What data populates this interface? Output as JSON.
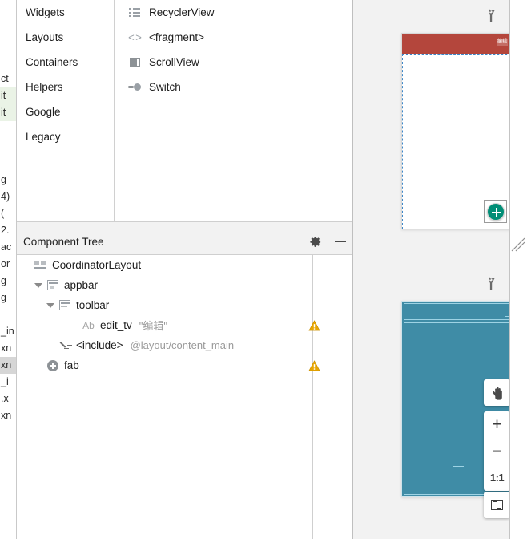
{
  "gutter": {
    "rows": [
      {
        "text": "",
        "state": "plain"
      },
      {
        "text": "",
        "state": "plain"
      },
      {
        "text": "",
        "state": "plain"
      },
      {
        "text": "",
        "state": "plain"
      },
      {
        "text": "ct",
        "state": "plain"
      },
      {
        "text": "it",
        "state": "green"
      },
      {
        "text": "it",
        "state": "green"
      },
      {
        "text": "",
        "state": "plain"
      },
      {
        "text": "",
        "state": "plain"
      },
      {
        "text": "",
        "state": "plain"
      },
      {
        "text": "g",
        "state": "plain"
      },
      {
        "text": "4)",
        "state": "plain"
      },
      {
        "text": "(",
        "state": "plain"
      },
      {
        "text": "2.",
        "state": "plain"
      },
      {
        "text": "ac",
        "state": "plain"
      },
      {
        "text": "or",
        "state": "plain"
      },
      {
        "text": "g",
        "state": "plain"
      },
      {
        "text": "g",
        "state": "plain"
      },
      {
        "text": "",
        "state": "plain"
      },
      {
        "text": "_in",
        "state": "plain"
      },
      {
        "text": "xn",
        "state": "plain"
      },
      {
        "text": "xn",
        "state": "sel"
      },
      {
        "text": "_i",
        "state": "plain"
      },
      {
        "text": ".x",
        "state": "plain"
      },
      {
        "text": "xn",
        "state": "plain"
      }
    ]
  },
  "palette": {
    "categories": [
      {
        "label": "Widgets"
      },
      {
        "label": "Layouts"
      },
      {
        "label": "Containers"
      },
      {
        "label": "Helpers"
      },
      {
        "label": "Google"
      },
      {
        "label": "Legacy"
      }
    ],
    "items": [
      {
        "label": "RecyclerView",
        "icon": "list-icon"
      },
      {
        "label": "<fragment>",
        "icon": "code-brackets-icon"
      },
      {
        "label": "ScrollView",
        "icon": "scrollview-icon"
      },
      {
        "label": "Switch",
        "icon": "switch-icon"
      }
    ]
  },
  "component_tree": {
    "title": "Component Tree",
    "gear_label": "gear-icon",
    "minimize_label": "minimize-icon",
    "nodes": [
      {
        "label": "CoordinatorLayout",
        "sub": "",
        "icon": "coordinator-layout-icon",
        "indent": 0,
        "twisty": "none",
        "warning": false
      },
      {
        "label": "appbar",
        "sub": "",
        "icon": "appbar-icon",
        "indent": 1,
        "twisty": "open",
        "warning": false
      },
      {
        "label": "toolbar",
        "sub": "",
        "icon": "toolbar-icon",
        "indent": 2,
        "twisty": "open",
        "warning": false
      },
      {
        "label": "edit_tv",
        "sub": "\"编辑\"",
        "icon": "textview-ab-icon",
        "indent": 4,
        "twisty": "none",
        "warning": true
      },
      {
        "label": "<include>",
        "sub": "@layout/content_main",
        "icon": "include-icon",
        "indent": 2,
        "twisty": "none",
        "warning": false
      },
      {
        "label": "fab",
        "sub": "",
        "icon": "fab-icon",
        "indent": 1,
        "twisty": "none",
        "warning": true
      }
    ]
  },
  "preview": {
    "design": {
      "name": "design-preview",
      "wrench_label": "wrench-icon",
      "toolbar_text": "编辑",
      "toolbar_color": "#b4463c",
      "fab_color": "#018e76",
      "selection_color": "#3b86c8"
    },
    "blueprint": {
      "name": "blueprint-preview",
      "wrench_label": "wrench-icon",
      "background_color": "#3f8ca6",
      "outline_color": "#9ed3e4"
    }
  },
  "zoom_controls": {
    "pan_label": "pan-hand-icon",
    "zoom_in_label": "+",
    "zoom_out_label": "−",
    "actual_size_label": "1:1",
    "fit_label": "fit-to-screen-icon"
  }
}
